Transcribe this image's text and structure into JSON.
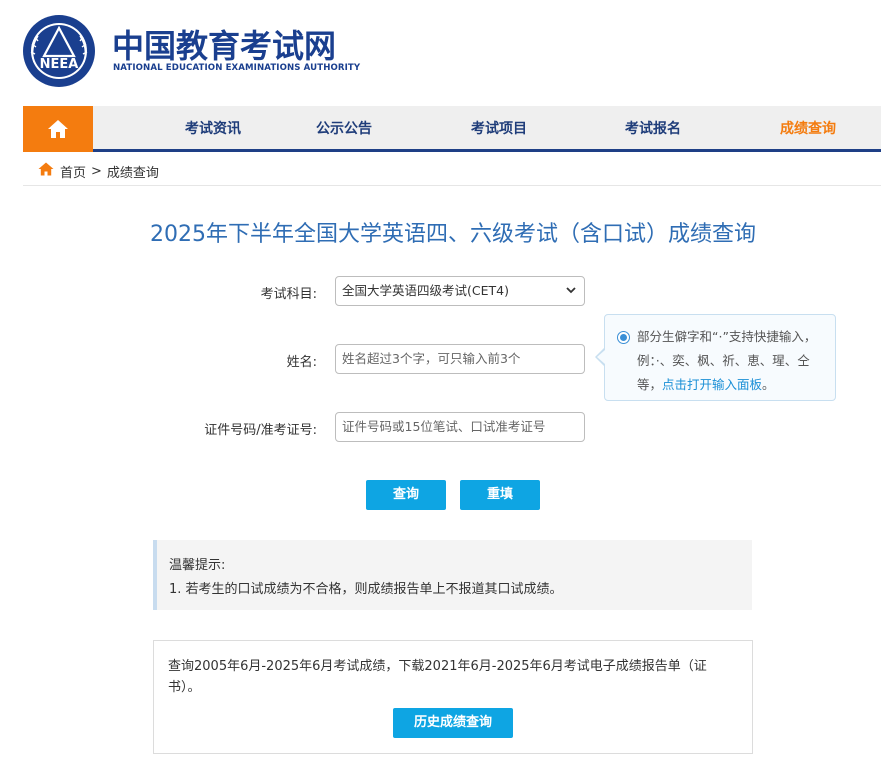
{
  "header": {
    "logo_emblem_text": "NEEA",
    "logo_cn": "中国教育考试网",
    "logo_en": "NATIONAL EDUCATION EXAMINATIONS AUTHORITY"
  },
  "nav": {
    "home_icon": "home-icon",
    "items": [
      {
        "label": "考试资讯",
        "active": false
      },
      {
        "label": "公示公告",
        "active": false
      },
      {
        "label": "考试项目",
        "active": false
      },
      {
        "label": "考试报名",
        "active": false
      },
      {
        "label": "成绩查询",
        "active": true
      }
    ],
    "colors": {
      "home_bg": "#f47c0f",
      "active": "#f47c0f",
      "text": "#1f3d7a",
      "underline": "#1e3f86"
    }
  },
  "breadcrumb": {
    "home": "首页",
    "separator": ">",
    "current": "成绩查询"
  },
  "page": {
    "title": "2025年下半年全国大学英语四、六级考试（含口试）成绩查询"
  },
  "form": {
    "subject_label": "考试科目:",
    "subject_value": "全国大学英语四级考试(CET4)",
    "name_label": "姓名:",
    "name_placeholder": "姓名超过3个字，可只输入前3个",
    "id_label": "证件号码/准考证号:",
    "id_placeholder": "证件号码或15位笔试、口试准考证号"
  },
  "tip": {
    "text": "部分生僻字和“·”支持快捷输入，例：·、奕、枫、祈、恵、瑆、仝等，",
    "link": "点击打开输入面板",
    "end": "。"
  },
  "buttons": {
    "query": "查询",
    "reset": "重填",
    "color": "#0ea5e3"
  },
  "notice": {
    "title": "温馨提示:",
    "item1": "1. 若考生的口试成绩为不合格，则成绩报告单上不报道其口试成绩。"
  },
  "history": {
    "text": "查询2005年6月-2025年6月考试成绩，下载2021年6月-2025年6月考试电子成绩报告单（证书）。",
    "button": "历史成绩查询"
  }
}
